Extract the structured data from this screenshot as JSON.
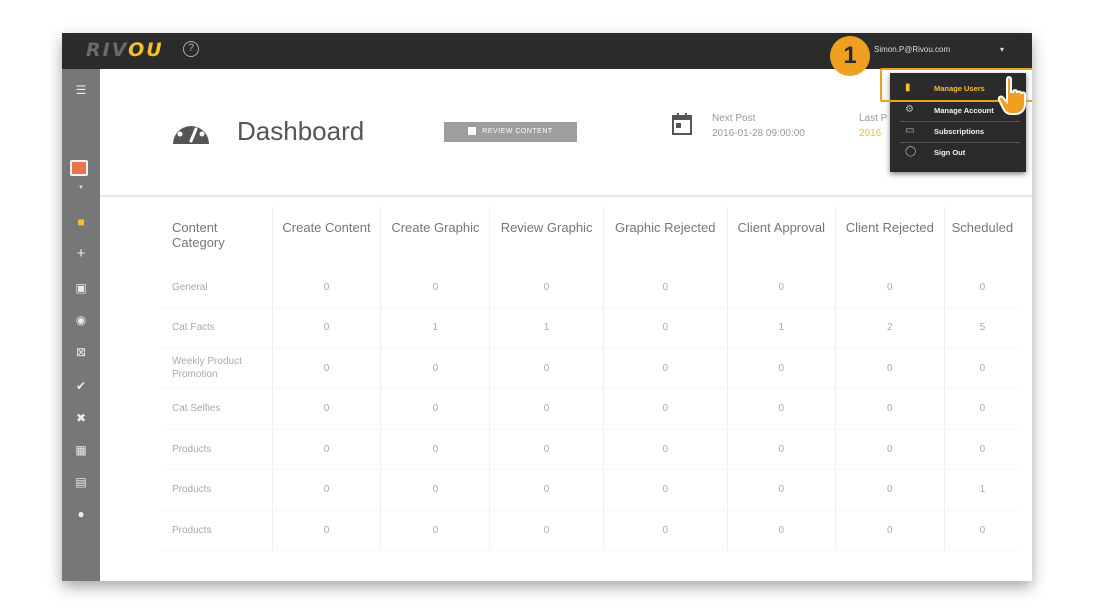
{
  "app": {
    "logo_main": "RIV",
    "logo_accent": "OU"
  },
  "topbar": {
    "user_email": "Simon.P@Rivou.com",
    "caret": "▾"
  },
  "header": {
    "title": "Dashboard",
    "review_button_label": "REVIEW CONTENT",
    "next_post_label": "Next Post",
    "next_post_value": "2016-01-28 09:00:00",
    "last_post_label": "Last P",
    "last_post_value": "2016"
  },
  "user_menu": {
    "items": [
      {
        "label": "Manage Users",
        "icon": "clipboard-icon"
      },
      {
        "label": "Manage Account",
        "icon": "gear-icon"
      },
      {
        "label": "Subscriptions",
        "icon": "card-icon"
      },
      {
        "label": "Sign Out",
        "icon": "pin-icon"
      }
    ]
  },
  "tutorial": {
    "step": "1"
  },
  "table": {
    "headers": [
      "Content Category",
      "Create Content",
      "Create Graphic",
      "Review Graphic",
      "Graphic Rejected",
      "Client Approval",
      "Client Rejected",
      "Scheduled"
    ],
    "rows": [
      [
        "General",
        "0",
        "0",
        "0",
        "0",
        "0",
        "0",
        "0"
      ],
      [
        "Cat Facts",
        "0",
        "1",
        "1",
        "0",
        "1",
        "2",
        "5"
      ],
      [
        "Weekly Product Promotion",
        "0",
        "0",
        "0",
        "0",
        "0",
        "0",
        "0"
      ],
      [
        "Cat Selfies",
        "0",
        "0",
        "0",
        "0",
        "0",
        "0",
        "0"
      ],
      [
        "Products",
        "0",
        "0",
        "0",
        "0",
        "0",
        "0",
        "0"
      ],
      [
        "Products",
        "0",
        "0",
        "0",
        "0",
        "0",
        "0",
        "1"
      ],
      [
        "Products",
        "0",
        "0",
        "0",
        "0",
        "0",
        "0",
        "0"
      ]
    ]
  },
  "colors": {
    "accent": "#f5c02a",
    "topbar": "#2b2b2b",
    "sidebar": "#777777",
    "callout": "#f0a020"
  }
}
